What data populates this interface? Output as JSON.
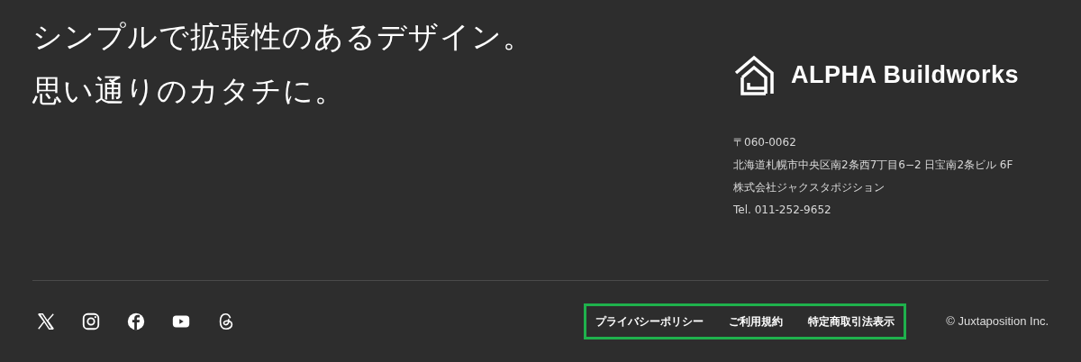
{
  "headline": [
    "シンプルで拡張性のあるデザイン。",
    "思い通りのカタチに。"
  ],
  "brand": {
    "name": "ALPHA Buildworks"
  },
  "address": [
    "〒060-0062",
    "北海道札幌市中央区南2条西7丁目6−2 日宝南2条ビル 6F",
    "株式会社ジャクスタポジション",
    "Tel. 011-252-9652"
  ],
  "social": [
    {
      "kind": "x"
    },
    {
      "kind": "instagram"
    },
    {
      "kind": "facebook"
    },
    {
      "kind": "youtube"
    },
    {
      "kind": "threads"
    }
  ],
  "footer_links": [
    "プライバシーポリシー",
    "ご利用規約",
    "特定商取引法表示"
  ],
  "copyright": "© Juxtaposition Inc."
}
